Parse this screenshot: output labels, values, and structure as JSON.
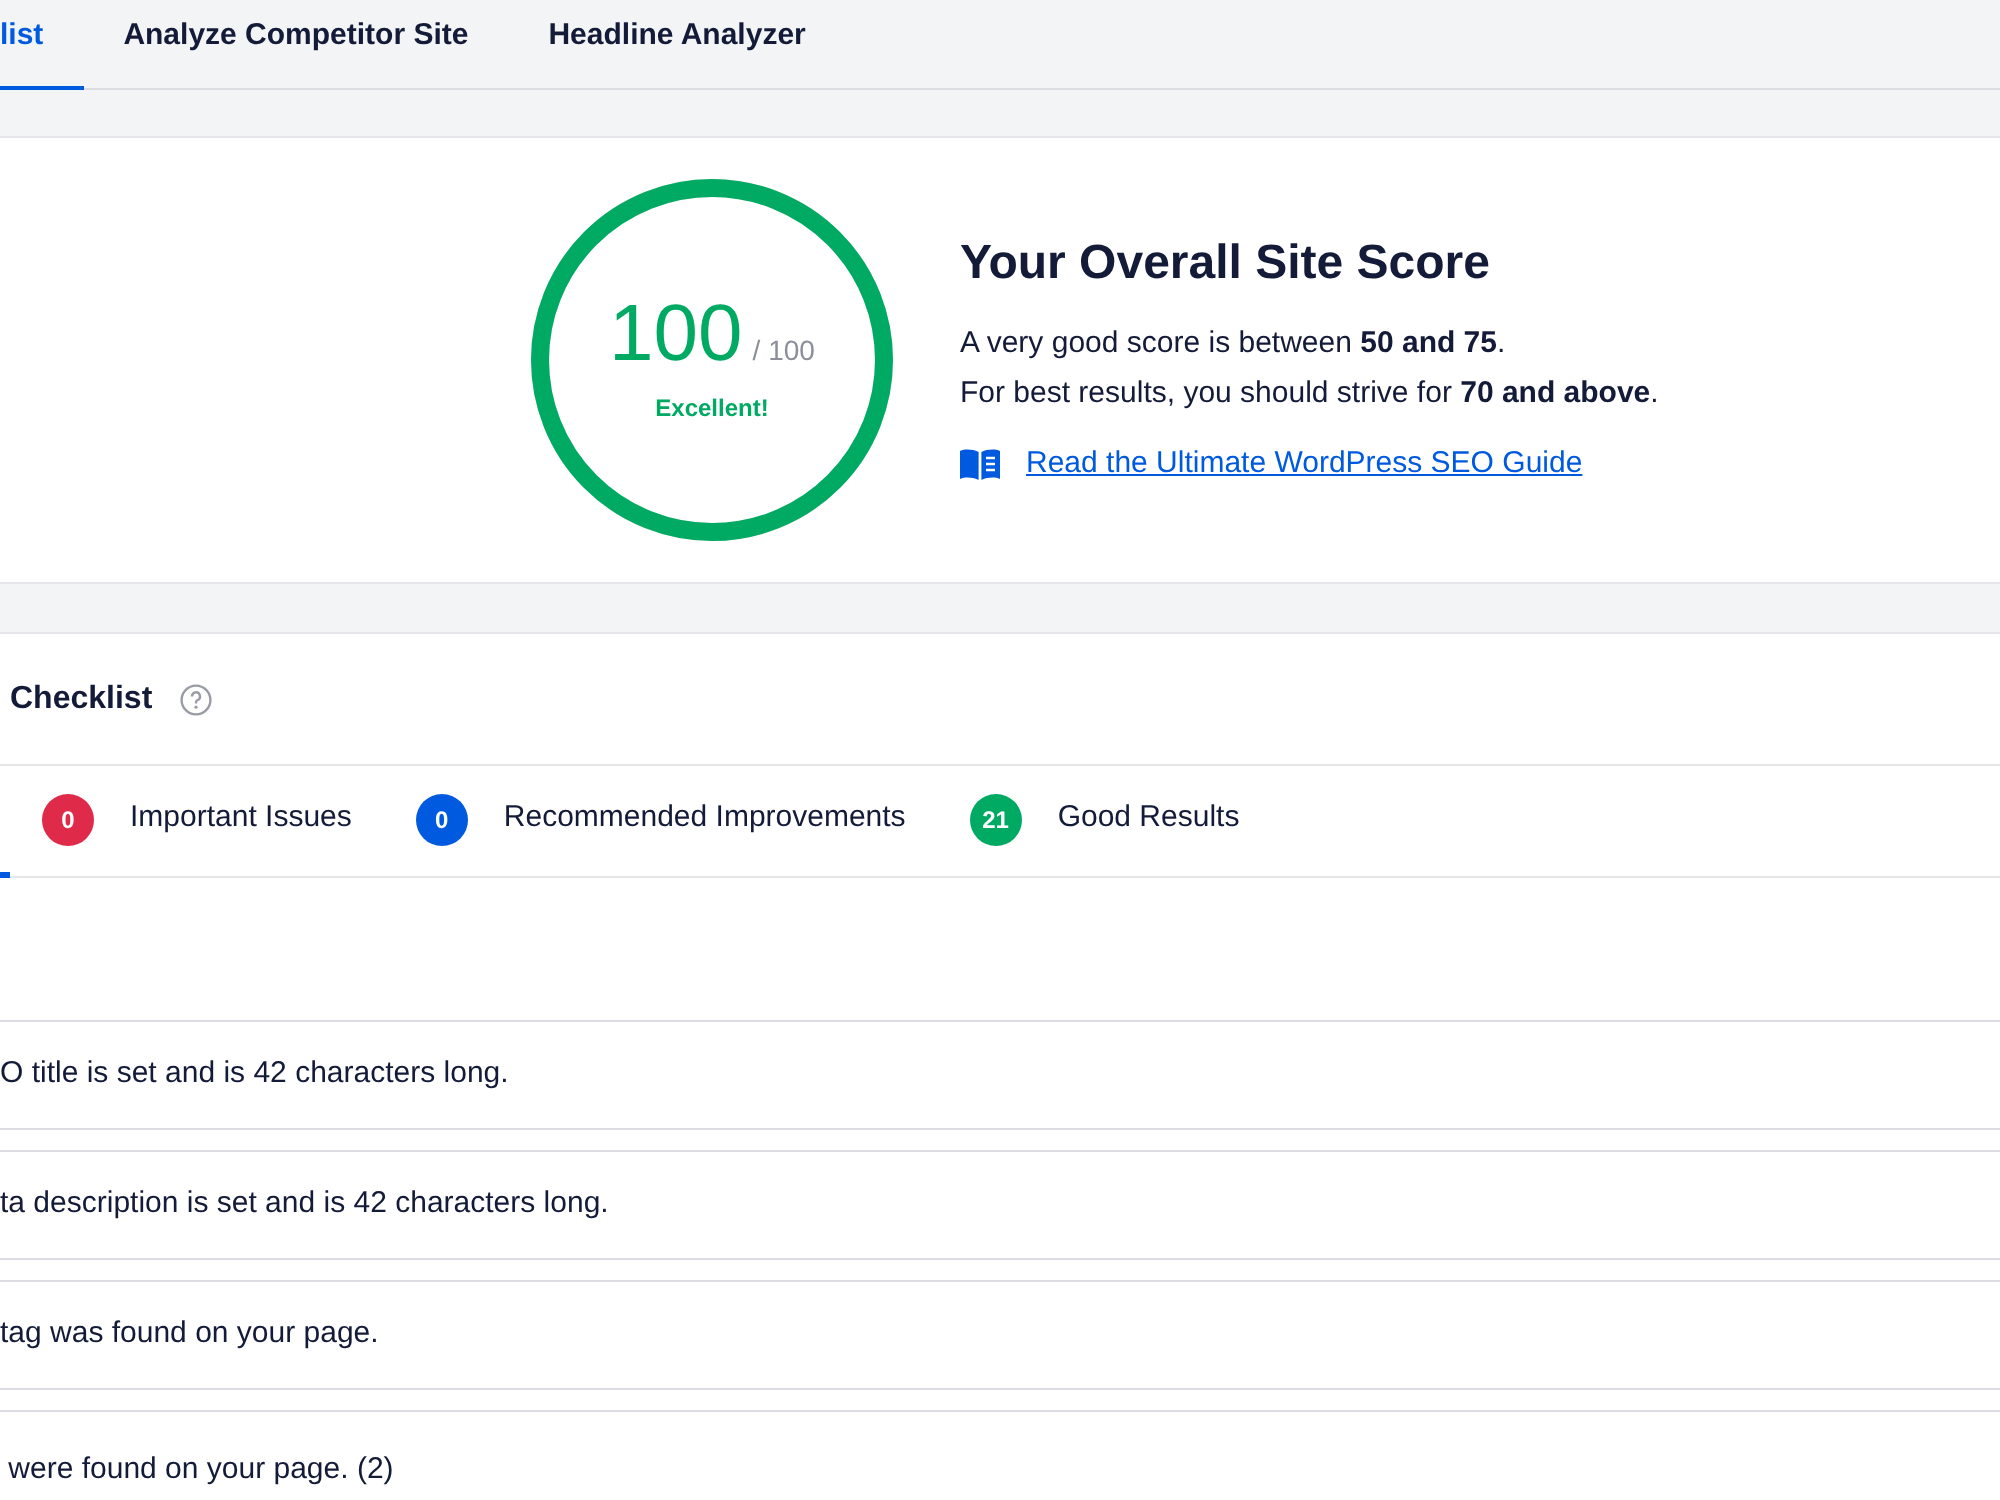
{
  "nav_tabs": [
    {
      "label": "list",
      "selected": true
    },
    {
      "label": "Analyze Competitor Site",
      "selected": false
    },
    {
      "label": "Headline Analyzer",
      "selected": false
    }
  ],
  "score_card": {
    "score": "100",
    "max": "/ 100",
    "rating": "Excellent!",
    "level": 1,
    "title": "Your Overall Site Score",
    "lines": [
      "A very good score is between **50 and 75**.",
      "For best results, you should strive for **70 and above**."
    ],
    "link": "Read the Ultimate WordPress SEO Guide"
  },
  "checklist": {
    "title": "Checklist",
    "tabs": [
      {
        "selected": true
      },
      {
        "count": "0",
        "label": "Important Issues",
        "color": "#df2a4a",
        "selected": false
      },
      {
        "count": "0",
        "label": "Recommended Improvements",
        "color": "#005ae0",
        "selected": false
      },
      {
        "count": "21",
        "label": "Good Results",
        "color": "#00aa63",
        "selected": false
      }
    ],
    "items": [
      "O title is set and is 42 characters long.",
      "ta description is set and is 42 characters long.",
      "tag was found on your page.",
      " were found on your page. (2)"
    ]
  }
}
